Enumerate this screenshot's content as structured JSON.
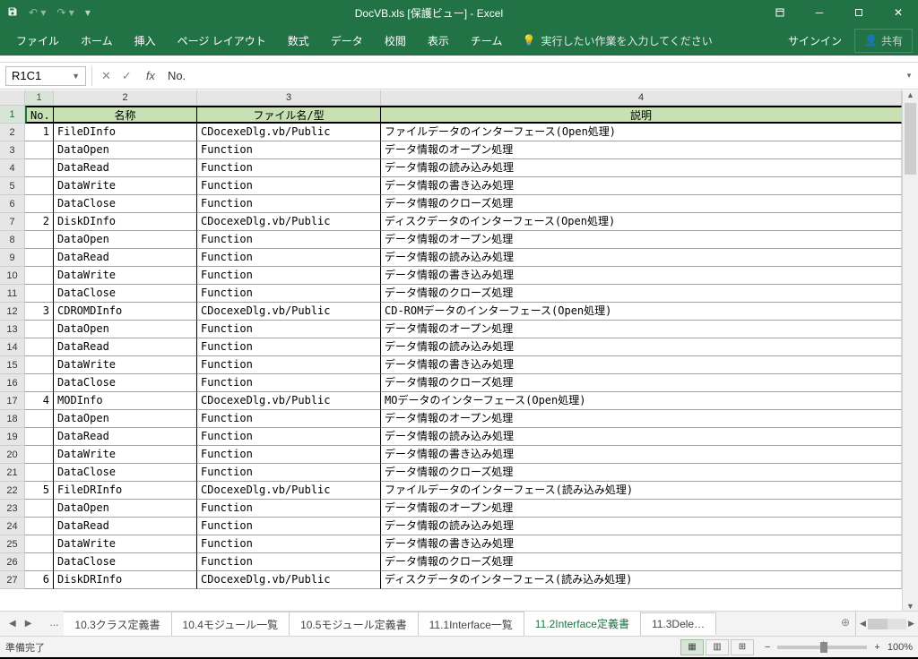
{
  "titlebar": {
    "title": "DocVB.xls  [保護ビュー] - Excel"
  },
  "ribbon": {
    "tabs": [
      "ファイル",
      "ホーム",
      "挿入",
      "ページ レイアウト",
      "数式",
      "データ",
      "校閲",
      "表示",
      "チーム"
    ],
    "tell": "実行したい作業を入力してください",
    "signin": "サインイン",
    "share": "共有"
  },
  "formula": {
    "name_box": "R1C1",
    "value": "No."
  },
  "columns": [
    "1",
    "2",
    "3",
    "4"
  ],
  "headers": {
    "no": "No.",
    "name": "名称",
    "file": "ファイル名/型",
    "desc": "説明"
  },
  "rows": [
    {
      "no": "1",
      "name": "FileDInfo",
      "file": "CDocexeDlg.vb/Public",
      "desc": "ファイルデータのインターフェース(Open処理)"
    },
    {
      "no": "",
      "name": "DataOpen",
      "file": "Function",
      "desc": "データ情報のオープン処理"
    },
    {
      "no": "",
      "name": "DataRead",
      "file": "Function",
      "desc": "データ情報の読み込み処理"
    },
    {
      "no": "",
      "name": "DataWrite",
      "file": "Function",
      "desc": "データ情報の書き込み処理"
    },
    {
      "no": "",
      "name": "DataClose",
      "file": "Function",
      "desc": "データ情報のクローズ処理"
    },
    {
      "no": "2",
      "name": "DiskDInfo",
      "file": "CDocexeDlg.vb/Public",
      "desc": "ディスクデータのインターフェース(Open処理)"
    },
    {
      "no": "",
      "name": "DataOpen",
      "file": "Function",
      "desc": "データ情報のオープン処理"
    },
    {
      "no": "",
      "name": "DataRead",
      "file": "Function",
      "desc": "データ情報の読み込み処理"
    },
    {
      "no": "",
      "name": "DataWrite",
      "file": "Function",
      "desc": "データ情報の書き込み処理"
    },
    {
      "no": "",
      "name": "DataClose",
      "file": "Function",
      "desc": "データ情報のクローズ処理"
    },
    {
      "no": "3",
      "name": "CDROMDInfo",
      "file": "CDocexeDlg.vb/Public",
      "desc": "CD-ROMデータのインターフェース(Open処理)"
    },
    {
      "no": "",
      "name": "DataOpen",
      "file": "Function",
      "desc": "データ情報のオープン処理"
    },
    {
      "no": "",
      "name": "DataRead",
      "file": "Function",
      "desc": "データ情報の読み込み処理"
    },
    {
      "no": "",
      "name": "DataWrite",
      "file": "Function",
      "desc": "データ情報の書き込み処理"
    },
    {
      "no": "",
      "name": "DataClose",
      "file": "Function",
      "desc": "データ情報のクローズ処理"
    },
    {
      "no": "4",
      "name": "MODInfo",
      "file": "CDocexeDlg.vb/Public",
      "desc": "MOデータのインターフェース(Open処理)"
    },
    {
      "no": "",
      "name": "DataOpen",
      "file": "Function",
      "desc": "データ情報のオープン処理"
    },
    {
      "no": "",
      "name": "DataRead",
      "file": "Function",
      "desc": "データ情報の読み込み処理"
    },
    {
      "no": "",
      "name": "DataWrite",
      "file": "Function",
      "desc": "データ情報の書き込み処理"
    },
    {
      "no": "",
      "name": "DataClose",
      "file": "Function",
      "desc": "データ情報のクローズ処理"
    },
    {
      "no": "5",
      "name": "FileDRInfo",
      "file": "CDocexeDlg.vb/Public",
      "desc": "ファイルデータのインターフェース(読み込み処理)"
    },
    {
      "no": "",
      "name": "DataOpen",
      "file": "Function",
      "desc": "データ情報のオープン処理"
    },
    {
      "no": "",
      "name": "DataRead",
      "file": "Function",
      "desc": "データ情報の読み込み処理"
    },
    {
      "no": "",
      "name": "DataWrite",
      "file": "Function",
      "desc": "データ情報の書き込み処理"
    },
    {
      "no": "",
      "name": "DataClose",
      "file": "Function",
      "desc": "データ情報のクローズ処理"
    },
    {
      "no": "6",
      "name": "DiskDRInfo",
      "file": "CDocexeDlg.vb/Public",
      "desc": "ディスクデータのインターフェース(読み込み処理)"
    }
  ],
  "sheets": {
    "first": "...",
    "list": [
      "10.3クラス定義書",
      "10.4モジュール一覧",
      "10.5モジュール定義書",
      "11.1Interface一覧",
      "11.2Interface定義書",
      "11.3Dele…"
    ],
    "active": 4
  },
  "status": {
    "ready": "準備完了",
    "zoom": "100%"
  }
}
